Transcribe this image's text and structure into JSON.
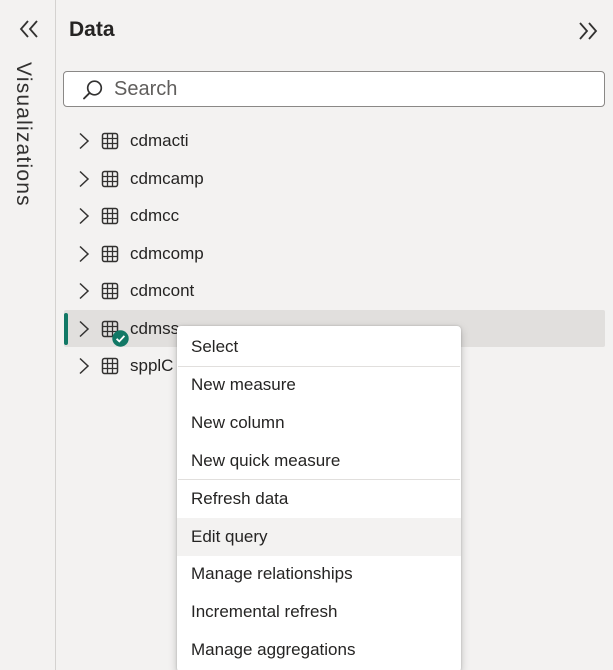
{
  "viz_rail": {
    "label": "Visualizations",
    "collapse_icon": "double-chevron-left-icon"
  },
  "data_pane": {
    "title": "Data",
    "expand_icon": "double-chevron-right-icon",
    "search": {
      "placeholder": "Search",
      "value": ""
    },
    "tables": [
      {
        "label": "cdmacti",
        "selected": false
      },
      {
        "label": "cdmcamp",
        "selected": false
      },
      {
        "label": "cdmcc",
        "selected": false
      },
      {
        "label": "cdmcomp",
        "selected": false
      },
      {
        "label": "cdmcont",
        "selected": false
      },
      {
        "label": "cdmss",
        "selected": true,
        "status_icon": "check-circle-icon"
      },
      {
        "label": "spplC",
        "selected": false
      }
    ]
  },
  "context_menu": {
    "groups": [
      [
        "Select"
      ],
      [
        "New measure",
        "New column",
        "New quick measure"
      ],
      [
        "Refresh data",
        "Edit query",
        "Manage relationships",
        "Incremental refresh",
        "Manage aggregations"
      ]
    ],
    "hovered_item": "Edit query"
  },
  "colors": {
    "background": "#f3f2f1",
    "accent": "#117865",
    "selected_row": "#e1dfdd",
    "menu_background": "#ffffff"
  }
}
